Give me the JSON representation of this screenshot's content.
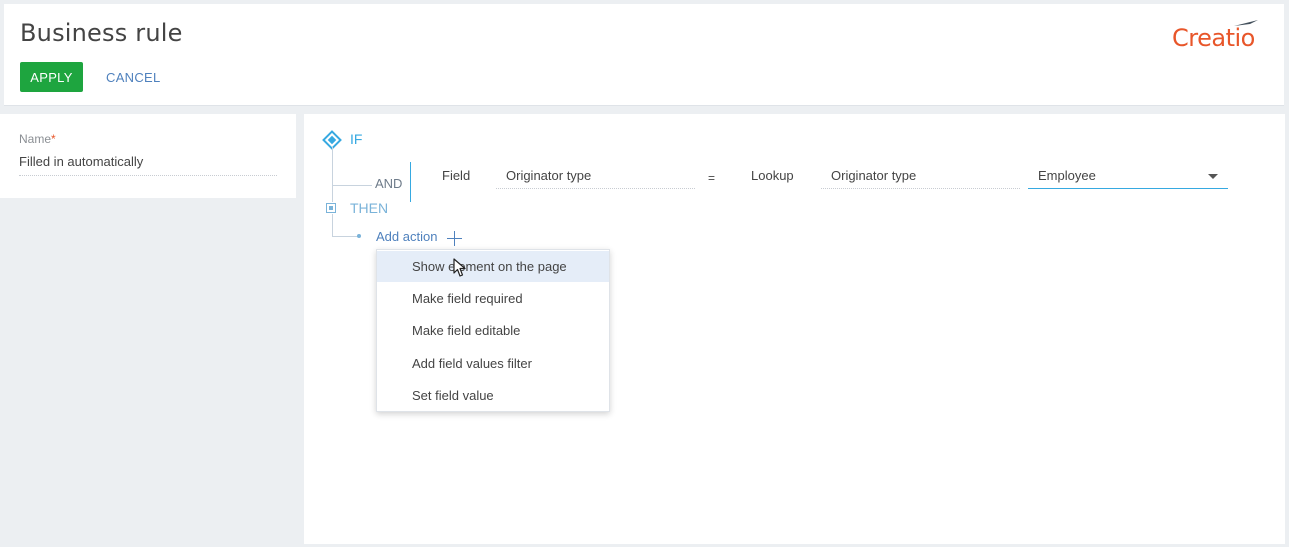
{
  "header": {
    "title": "Business rule",
    "apply_label": "APPLY",
    "cancel_label": "CANCEL",
    "logo_text": "Creatio"
  },
  "name_field": {
    "label": "Name",
    "required_mark": "*",
    "value": "Filled in automatically"
  },
  "rule": {
    "if_label": "IF",
    "and_label": "AND",
    "condition": {
      "field_label": "Field",
      "field_value": "Originator type",
      "operator": "=",
      "lookup_label": "Lookup",
      "lookup_value": "Originator type",
      "selected_value": "Employee"
    },
    "then_label": "THEN",
    "add_action_label": "Add action"
  },
  "action_menu": {
    "items": [
      {
        "label": "Show element on the page"
      },
      {
        "label": "Make field required"
      },
      {
        "label": "Make field editable"
      },
      {
        "label": "Add field values filter"
      },
      {
        "label": "Set field value"
      }
    ]
  },
  "colors": {
    "accent": "#36a9e1",
    "apply": "#1ea53f",
    "link": "#4f81bd",
    "brand": "#e8562a"
  }
}
